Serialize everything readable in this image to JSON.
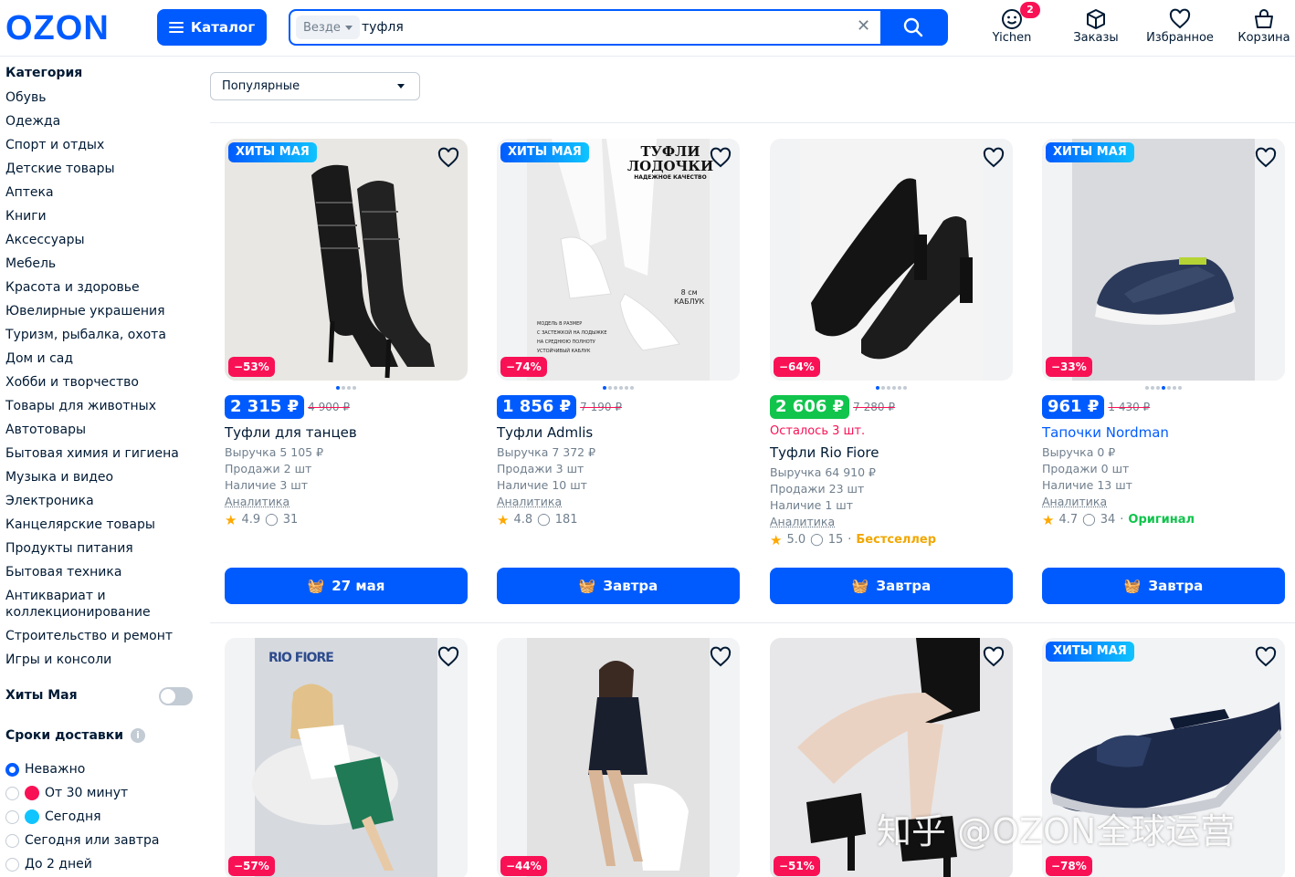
{
  "header": {
    "logo": "OZON",
    "catalog_label": "Каталог",
    "search_scope": "Везде",
    "search_value": "туфля",
    "nav": [
      {
        "label": "Yichen",
        "icon": "smiley-icon",
        "badge": "2"
      },
      {
        "label": "Заказы",
        "icon": "box-icon"
      },
      {
        "label": "Избранное",
        "icon": "heart-icon"
      },
      {
        "label": "Корзина",
        "icon": "basket-icon"
      }
    ]
  },
  "sidebar": {
    "category_title": "Категория",
    "categories": [
      "Обувь",
      "Одежда",
      "Спорт и отдых",
      "Детские товары",
      "Аптека",
      "Книги",
      "Аксессуары",
      "Мебель",
      "Красота и здоровье",
      "Ювелирные украшения",
      "Туризм, рыбалка, охота",
      "Дом и сад",
      "Хобби и творчество",
      "Товары для животных",
      "Автотовары",
      "Бытовая химия и гигиена",
      "Музыка и видео",
      "Электроника",
      "Канцелярские товары",
      "Продукты питания",
      "Бытовая техника",
      "Антиквариат и коллекционирование",
      "Строительство и ремонт",
      "Игры и консоли"
    ],
    "hits_label": "Хиты Мая",
    "delivery_title": "Сроки доставки",
    "delivery_options": [
      {
        "label": "Неважно",
        "selected": true
      },
      {
        "label": "От 30 минут",
        "selected": false
      },
      {
        "label": "Сегодня",
        "selected": false
      },
      {
        "label": "Сегодня или завтра",
        "selected": false
      },
      {
        "label": "До 2 дней",
        "selected": false
      }
    ]
  },
  "sort": {
    "value": "Популярные"
  },
  "products": [
    {
      "hit": "ХИТЫ МАЯ",
      "discount": "−53%",
      "price": "2 315 ₽",
      "old_price": "4 900 ₽",
      "title": "Туфли для танцев",
      "metrics": [
        "Выручка 5 105 ₽",
        "Продажи 2 шт",
        "Наличие 3 шт"
      ],
      "analytics": "Аналитика",
      "rating": "4.9",
      "reviews": "31",
      "button": "27 мая"
    },
    {
      "hit": "ХИТЫ МАЯ",
      "discount": "−74%",
      "price": "1 856 ₽",
      "old_price": "7 190 ₽",
      "title": "Туфли Admlis",
      "metrics": [
        "Выручка 7 372 ₽",
        "Продажи 3 шт",
        "Наличие 10 шт"
      ],
      "analytics": "Аналитика",
      "rating": "4.8",
      "reviews": "181",
      "button": "Завтра",
      "img_text": [
        "ТУФЛИ",
        "ЛОДОЧКИ",
        "НАДЕЖНОЕ КАЧЕСТВО",
        "8 см",
        "КАБЛУК",
        "МОДЕЛЬ В РАЗМЕР",
        "С ЗАСТЕЖКОЙ НА ЛОДЫЖКЕ",
        "НА СРЕДНЮЮ ПОЛНОТУ",
        "УСТОЙЧИВЫЙ КАБЛУК"
      ]
    },
    {
      "discount": "−64%",
      "price": "2 606 ₽",
      "old_price": "7 280 ₽",
      "remain": "Осталось 3 шт.",
      "title": "Туфли Rio Fiore",
      "metrics": [
        "Выручка 64 910 ₽",
        "Продажи 23 шт",
        "Наличие 1 шт"
      ],
      "analytics": "Аналитика",
      "rating": "5.0",
      "reviews": "15",
      "extra": "Бестселлер",
      "button": "Завтра"
    },
    {
      "hit": "ХИТЫ МАЯ",
      "discount": "−33%",
      "price": "961 ₽",
      "old_price": "1 430 ₽",
      "title": "Тапочки Nordman",
      "metrics": [
        "Выручка 0 ₽",
        "Продажи 0 шт",
        "Наличие 13 шт"
      ],
      "analytics": "Аналитика",
      "rating": "4.7",
      "reviews": "34",
      "extra": "Оригинал",
      "button": "Завтра"
    },
    {
      "discount": "−57%",
      "img_text": [
        "RIO FIORE"
      ]
    },
    {
      "discount": "−44%"
    },
    {
      "discount": "−51%"
    },
    {
      "hit": "ХИТЫ МАЯ",
      "discount": "−78%"
    }
  ],
  "watermark": "知乎 @OZON全球运营",
  "colors": {
    "brand": "#005bff",
    "discount": "#f91155",
    "price_green": "#10c44c",
    "bestseller": "#f1a700"
  }
}
